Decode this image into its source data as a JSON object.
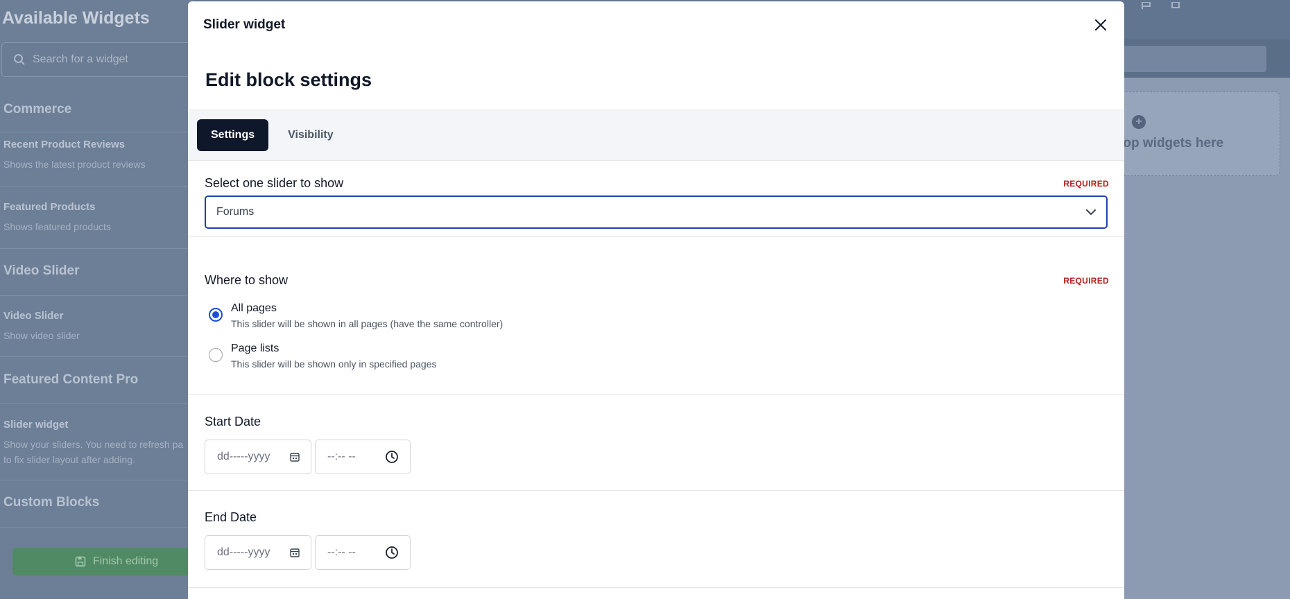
{
  "background": {
    "sidebar_title": "Available Widgets",
    "search_placeholder": "Search for a widget",
    "sections": [
      {
        "label": "Commerce"
      },
      {
        "label": "Video Slider"
      },
      {
        "label": "Featured Content Pro"
      },
      {
        "label": "Custom Blocks"
      }
    ],
    "widgets": [
      {
        "title": "Recent Product Reviews",
        "desc": "Shows the latest product reviews"
      },
      {
        "title": "Featured Products",
        "desc": "Shows featured products"
      },
      {
        "title": "Video Slider",
        "desc": "Show video slider"
      },
      {
        "title": "Slider widget",
        "desc_line1": "Show your sliders. You need to refresh pa",
        "desc_line2": "to fix slider layout after adding."
      }
    ],
    "finish_label": "Finish editing",
    "drop_text": "rop widgets here"
  },
  "modal": {
    "title": "Slider widget",
    "heading": "Edit block settings",
    "tabs": [
      {
        "label": "Settings",
        "active": true
      },
      {
        "label": "Visibility",
        "active": false
      }
    ],
    "slider_select": {
      "label": "Select one slider to show",
      "required": "REQUIRED",
      "value": "Forums"
    },
    "where_to_show": {
      "label": "Where to show",
      "required": "REQUIRED",
      "options": [
        {
          "title": "All pages",
          "desc": "This slider will be shown in all pages (have the same controller)",
          "checked": true
        },
        {
          "title": "Page lists",
          "desc": "This slider will be shown only in specified pages",
          "checked": false
        }
      ]
    },
    "start_date": {
      "label": "Start Date",
      "date_placeholder": "dd-----yyyy",
      "time_placeholder": "--:-- --"
    },
    "end_date": {
      "label": "End Date",
      "date_placeholder": "dd-----yyyy",
      "time_placeholder": "--:-- --"
    }
  },
  "colors": {
    "accent": "#1d4ed8",
    "tab_active_bg": "#0f172a",
    "required": "#b91c1c",
    "finish_button": "#4f8a64"
  }
}
